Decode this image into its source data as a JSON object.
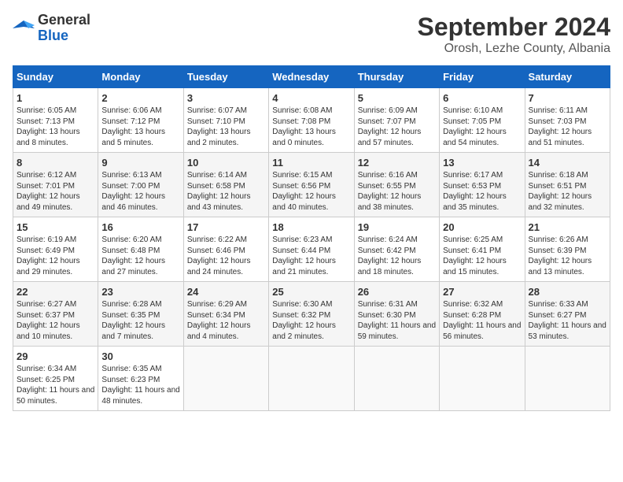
{
  "header": {
    "logo_general": "General",
    "logo_blue": "Blue",
    "month": "September 2024",
    "location": "Orosh, Lezhe County, Albania"
  },
  "weekdays": [
    "Sunday",
    "Monday",
    "Tuesday",
    "Wednesday",
    "Thursday",
    "Friday",
    "Saturday"
  ],
  "weeks": [
    [
      {
        "day": "1",
        "sunrise": "6:05 AM",
        "sunset": "7:13 PM",
        "daylight": "13 hours and 8 minutes."
      },
      {
        "day": "2",
        "sunrise": "6:06 AM",
        "sunset": "7:12 PM",
        "daylight": "13 hours and 5 minutes."
      },
      {
        "day": "3",
        "sunrise": "6:07 AM",
        "sunset": "7:10 PM",
        "daylight": "13 hours and 2 minutes."
      },
      {
        "day": "4",
        "sunrise": "6:08 AM",
        "sunset": "7:08 PM",
        "daylight": "13 hours and 0 minutes."
      },
      {
        "day": "5",
        "sunrise": "6:09 AM",
        "sunset": "7:07 PM",
        "daylight": "12 hours and 57 minutes."
      },
      {
        "day": "6",
        "sunrise": "6:10 AM",
        "sunset": "7:05 PM",
        "daylight": "12 hours and 54 minutes."
      },
      {
        "day": "7",
        "sunrise": "6:11 AM",
        "sunset": "7:03 PM",
        "daylight": "12 hours and 51 minutes."
      }
    ],
    [
      {
        "day": "8",
        "sunrise": "6:12 AM",
        "sunset": "7:01 PM",
        "daylight": "12 hours and 49 minutes."
      },
      {
        "day": "9",
        "sunrise": "6:13 AM",
        "sunset": "7:00 PM",
        "daylight": "12 hours and 46 minutes."
      },
      {
        "day": "10",
        "sunrise": "6:14 AM",
        "sunset": "6:58 PM",
        "daylight": "12 hours and 43 minutes."
      },
      {
        "day": "11",
        "sunrise": "6:15 AM",
        "sunset": "6:56 PM",
        "daylight": "12 hours and 40 minutes."
      },
      {
        "day": "12",
        "sunrise": "6:16 AM",
        "sunset": "6:55 PM",
        "daylight": "12 hours and 38 minutes."
      },
      {
        "day": "13",
        "sunrise": "6:17 AM",
        "sunset": "6:53 PM",
        "daylight": "12 hours and 35 minutes."
      },
      {
        "day": "14",
        "sunrise": "6:18 AM",
        "sunset": "6:51 PM",
        "daylight": "12 hours and 32 minutes."
      }
    ],
    [
      {
        "day": "15",
        "sunrise": "6:19 AM",
        "sunset": "6:49 PM",
        "daylight": "12 hours and 29 minutes."
      },
      {
        "day": "16",
        "sunrise": "6:20 AM",
        "sunset": "6:48 PM",
        "daylight": "12 hours and 27 minutes."
      },
      {
        "day": "17",
        "sunrise": "6:22 AM",
        "sunset": "6:46 PM",
        "daylight": "12 hours and 24 minutes."
      },
      {
        "day": "18",
        "sunrise": "6:23 AM",
        "sunset": "6:44 PM",
        "daylight": "12 hours and 21 minutes."
      },
      {
        "day": "19",
        "sunrise": "6:24 AM",
        "sunset": "6:42 PM",
        "daylight": "12 hours and 18 minutes."
      },
      {
        "day": "20",
        "sunrise": "6:25 AM",
        "sunset": "6:41 PM",
        "daylight": "12 hours and 15 minutes."
      },
      {
        "day": "21",
        "sunrise": "6:26 AM",
        "sunset": "6:39 PM",
        "daylight": "12 hours and 13 minutes."
      }
    ],
    [
      {
        "day": "22",
        "sunrise": "6:27 AM",
        "sunset": "6:37 PM",
        "daylight": "12 hours and 10 minutes."
      },
      {
        "day": "23",
        "sunrise": "6:28 AM",
        "sunset": "6:35 PM",
        "daylight": "12 hours and 7 minutes."
      },
      {
        "day": "24",
        "sunrise": "6:29 AM",
        "sunset": "6:34 PM",
        "daylight": "12 hours and 4 minutes."
      },
      {
        "day": "25",
        "sunrise": "6:30 AM",
        "sunset": "6:32 PM",
        "daylight": "12 hours and 2 minutes."
      },
      {
        "day": "26",
        "sunrise": "6:31 AM",
        "sunset": "6:30 PM",
        "daylight": "11 hours and 59 minutes."
      },
      {
        "day": "27",
        "sunrise": "6:32 AM",
        "sunset": "6:28 PM",
        "daylight": "11 hours and 56 minutes."
      },
      {
        "day": "28",
        "sunrise": "6:33 AM",
        "sunset": "6:27 PM",
        "daylight": "11 hours and 53 minutes."
      }
    ],
    [
      {
        "day": "29",
        "sunrise": "6:34 AM",
        "sunset": "6:25 PM",
        "daylight": "11 hours and 50 minutes."
      },
      {
        "day": "30",
        "sunrise": "6:35 AM",
        "sunset": "6:23 PM",
        "daylight": "11 hours and 48 minutes."
      },
      null,
      null,
      null,
      null,
      null
    ]
  ]
}
